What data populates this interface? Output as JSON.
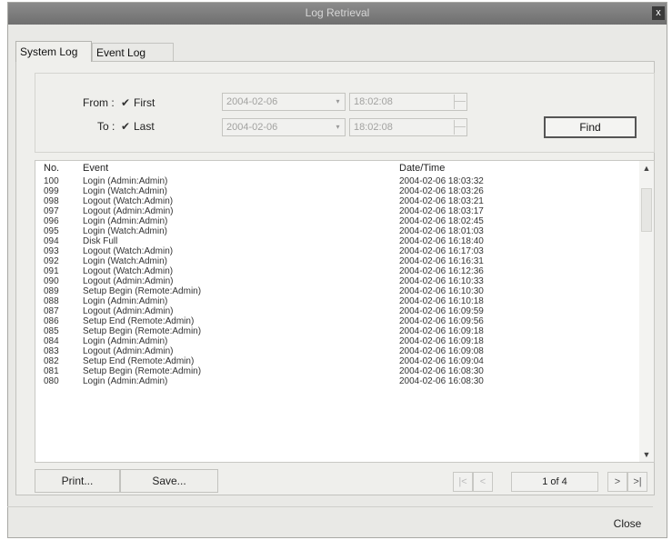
{
  "window": {
    "title": "Log Retrieval"
  },
  "tabs": [
    {
      "label": "System Log"
    },
    {
      "label": "Event Log"
    }
  ],
  "filter": {
    "from_label": "From :",
    "from_check": "First",
    "to_label": "To :",
    "to_check": "Last",
    "from_date": "2004-02-06",
    "from_time": "18:02:08",
    "to_date": "2004-02-06",
    "to_time": "18:02:08",
    "find_label": "Find"
  },
  "list": {
    "columns": [
      "No.",
      "Event",
      "Date/Time"
    ],
    "rows": [
      {
        "no": "100",
        "event": "Login (Admin:Admin)",
        "datetime": "2004-02-06 18:03:32"
      },
      {
        "no": "099",
        "event": "Login (Watch:Admin)",
        "datetime": "2004-02-06 18:03:26"
      },
      {
        "no": "098",
        "event": "Logout (Watch:Admin)",
        "datetime": "2004-02-06 18:03:21"
      },
      {
        "no": "097",
        "event": "Logout (Admin:Admin)",
        "datetime": "2004-02-06 18:03:17"
      },
      {
        "no": "096",
        "event": "Login (Admin:Admin)",
        "datetime": "2004-02-06 18:02:45"
      },
      {
        "no": "095",
        "event": "Login (Watch:Admin)",
        "datetime": "2004-02-06 18:01:03"
      },
      {
        "no": "094",
        "event": "Disk Full",
        "datetime": "2004-02-06 16:18:40"
      },
      {
        "no": "093",
        "event": "Logout (Watch:Admin)",
        "datetime": "2004-02-06 16:17:03"
      },
      {
        "no": "092",
        "event": "Login (Watch:Admin)",
        "datetime": "2004-02-06 16:16:31"
      },
      {
        "no": "091",
        "event": "Logout (Watch:Admin)",
        "datetime": "2004-02-06 16:12:36"
      },
      {
        "no": "090",
        "event": "Logout (Admin:Admin)",
        "datetime": "2004-02-06 16:10:33"
      },
      {
        "no": "089",
        "event": "Setup Begin (Remote:Admin)",
        "datetime": "2004-02-06 16:10:30"
      },
      {
        "no": "088",
        "event": "Login (Admin:Admin)",
        "datetime": "2004-02-06 16:10:18"
      },
      {
        "no": "087",
        "event": "Logout (Admin:Admin)",
        "datetime": "2004-02-06 16:09:59"
      },
      {
        "no": "086",
        "event": "Setup End (Remote:Admin)",
        "datetime": "2004-02-06 16:09:56"
      },
      {
        "no": "085",
        "event": "Setup Begin (Remote:Admin)",
        "datetime": "2004-02-06 16:09:18"
      },
      {
        "no": "084",
        "event": "Login (Admin:Admin)",
        "datetime": "2004-02-06 16:09:18"
      },
      {
        "no": "083",
        "event": "Logout (Admin:Admin)",
        "datetime": "2004-02-06 16:09:08"
      },
      {
        "no": "082",
        "event": "Setup End (Remote:Admin)",
        "datetime": "2004-02-06 16:09:04"
      },
      {
        "no": "081",
        "event": "Setup Begin (Remote:Admin)",
        "datetime": "2004-02-06 16:08:30"
      },
      {
        "no": "080",
        "event": "Login (Admin:Admin)",
        "datetime": "2004-02-06 16:08:30"
      }
    ]
  },
  "buttons": {
    "print": "Print...",
    "save": "Save...",
    "close": "Close"
  },
  "pagination": {
    "label": "1 of 4",
    "first": "|<",
    "prev": "<",
    "next": ">",
    "last": ">|"
  },
  "icons": {
    "checkmark": "✔",
    "dropdown": "▾",
    "scroll_up": "▲",
    "scroll_down": "▼",
    "close": "x"
  }
}
